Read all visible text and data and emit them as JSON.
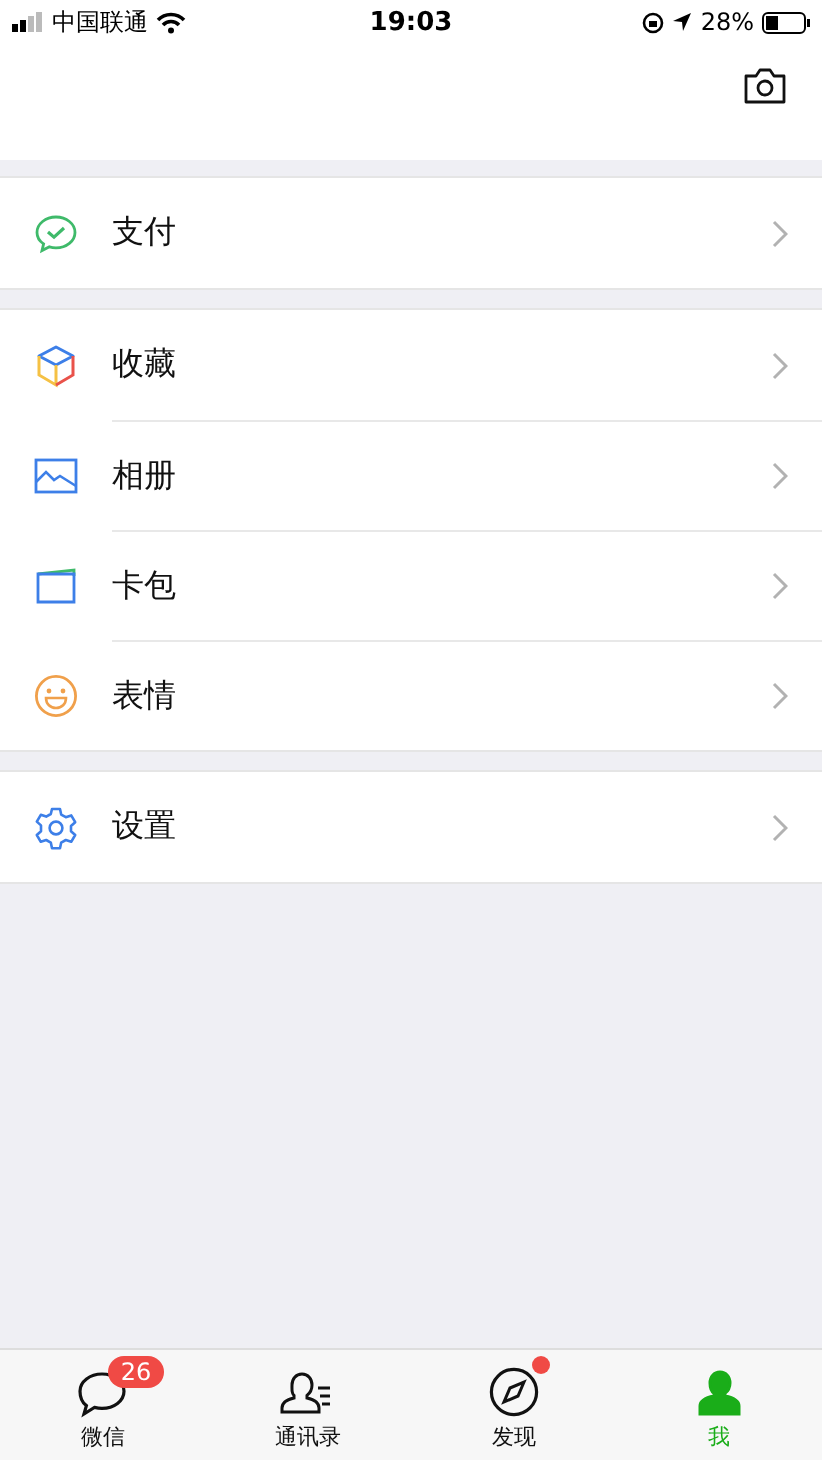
{
  "status_bar": {
    "carrier": "中国联通",
    "time": "19:03",
    "battery_text": "28%"
  },
  "groups": [
    {
      "items": [
        {
          "kind": "pay",
          "label": "支付"
        }
      ]
    },
    {
      "items": [
        {
          "kind": "favorites",
          "label": "收藏"
        },
        {
          "kind": "album",
          "label": "相册"
        },
        {
          "kind": "cards",
          "label": "卡包"
        },
        {
          "kind": "stickers",
          "label": "表情"
        }
      ]
    },
    {
      "items": [
        {
          "kind": "settings",
          "label": "设置"
        }
      ]
    }
  ],
  "tabs": [
    {
      "kind": "chats",
      "label": "微信",
      "badge": "26",
      "dot": false,
      "selected": false
    },
    {
      "kind": "contacts",
      "label": "通讯录",
      "dot": false,
      "selected": false
    },
    {
      "kind": "discover",
      "label": "发现",
      "dot": true,
      "selected": false
    },
    {
      "kind": "me",
      "label": "我",
      "dot": false,
      "selected": true
    }
  ]
}
